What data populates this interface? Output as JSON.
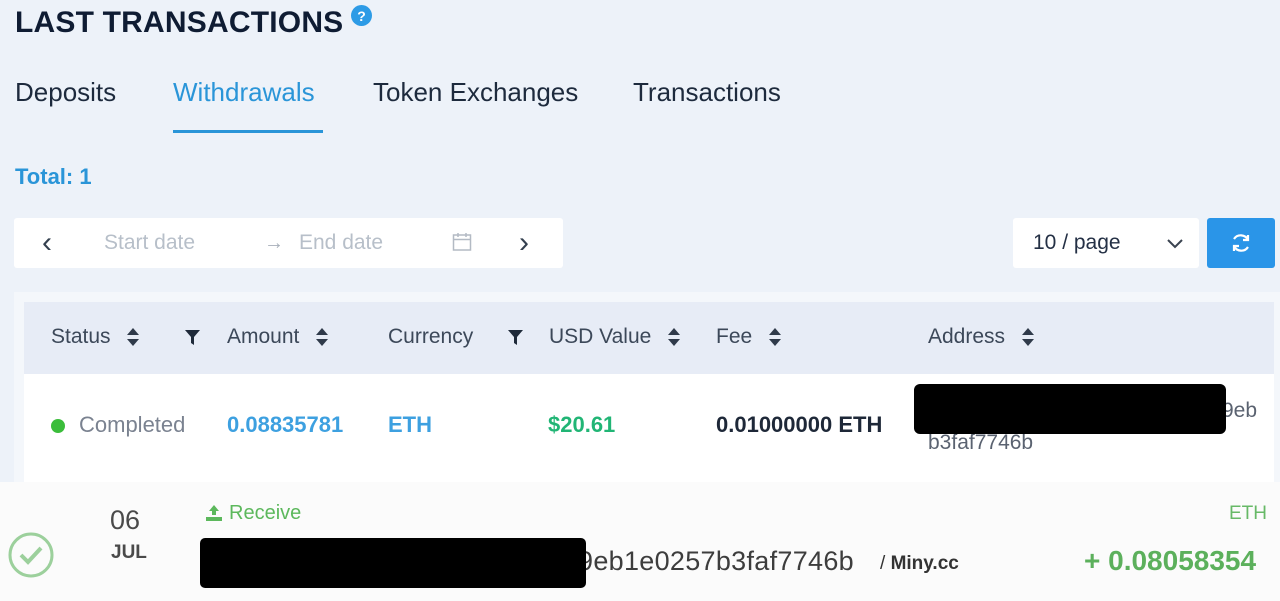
{
  "header": {
    "title": "LAST TRANSACTIONS",
    "help_icon": "?"
  },
  "tabs": [
    {
      "label": "Deposits",
      "active": false
    },
    {
      "label": "Withdrawals",
      "active": true
    },
    {
      "label": "Token Exchanges",
      "active": false
    },
    {
      "label": "Transactions",
      "active": false
    }
  ],
  "total": "Total: 1",
  "date_range": {
    "start_placeholder": "Start date",
    "arrow": "→",
    "end_placeholder": "End date",
    "prev": "‹",
    "next": "›"
  },
  "pagination": {
    "page_size": "10 / page"
  },
  "table": {
    "columns": [
      "Status",
      "Amount",
      "Currency",
      "USD Value",
      "Fee",
      "Address"
    ],
    "rows": [
      {
        "status": "Completed",
        "amount": "0.08835781",
        "currency": "ETH",
        "usd_value": "$20.61",
        "fee": "0.01000000 ETH",
        "address_visible_1": "9eb",
        "address_visible_2": "b3faf7746b"
      }
    ]
  },
  "notification": {
    "day": "06",
    "month": "JUL",
    "type": "Receive",
    "address_visible": "9eb1e0257b3faf7746b",
    "separator": "/",
    "site": "Miny.cc",
    "currency": "ETH",
    "amount": "+ 0.08058354"
  },
  "colors": {
    "accent": "#2a95d8",
    "success": "#3bbd3b",
    "usd_green": "#21b575",
    "background": "#edf2f9"
  }
}
